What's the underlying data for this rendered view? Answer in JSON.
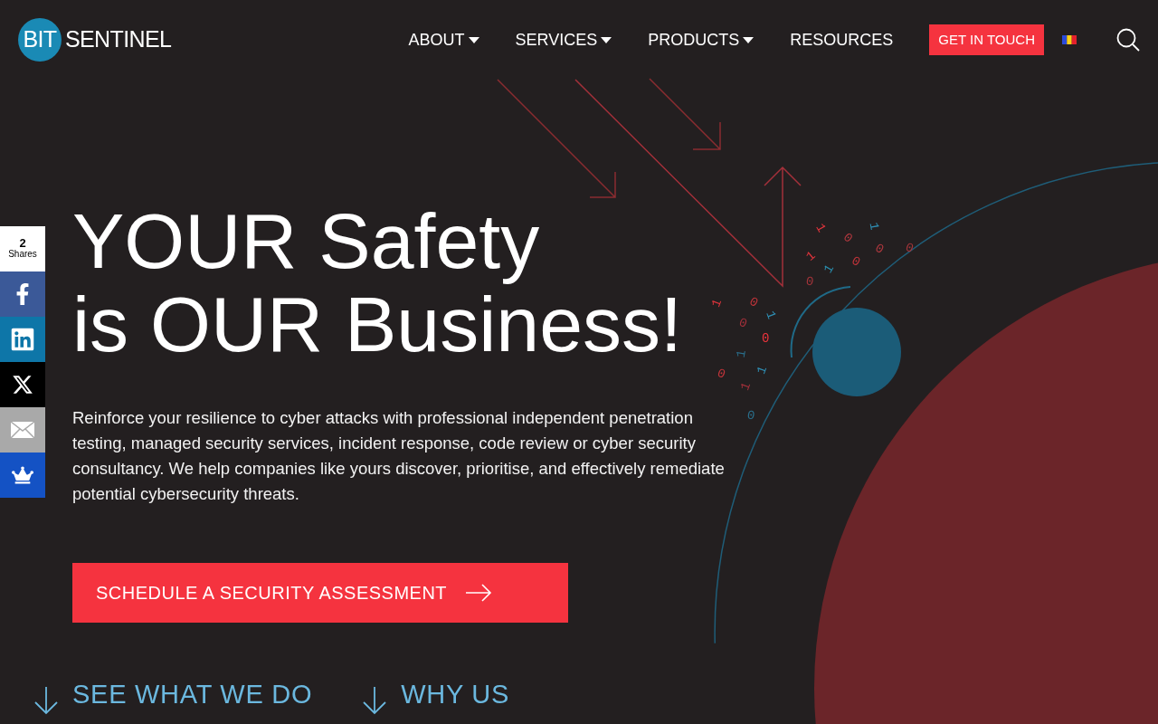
{
  "logo": {
    "mark": "BIT",
    "name": "SENTINEL"
  },
  "nav": [
    {
      "label": "ABOUT",
      "dropdown": true
    },
    {
      "label": "SERVICES",
      "dropdown": true
    },
    {
      "label": "PRODUCTS",
      "dropdown": true
    },
    {
      "label": "RESOURCES",
      "dropdown": false
    }
  ],
  "cta_nav": "GET IN TOUCH",
  "share_bar": {
    "count": "2",
    "label": "Shares",
    "buttons": [
      {
        "kind": "facebook"
      },
      {
        "kind": "linkedin"
      },
      {
        "kind": "x"
      },
      {
        "kind": "email"
      },
      {
        "kind": "crown"
      }
    ]
  },
  "hero": {
    "title_lines": [
      "YOUR Safety",
      "is OUR Business!"
    ],
    "text": "Reinforce your resilience to cyber attacks with professional independent penetration testing, managed security services, incident response, code review or cyber security consultancy. We help companies like yours discover, prioritise, and effectively remediate potential cybersecurity threats.",
    "button": "SCHEDULE A SECURITY ASSESSMENT"
  },
  "scroll_links": [
    "SEE WHAT WE DO",
    "WHY US"
  ],
  "binary_digits": [
    "1",
    "0",
    "1",
    "0",
    "0",
    "1",
    "1",
    "0",
    "0",
    "1",
    "0",
    "1",
    "0",
    "0",
    "1",
    "1",
    "0",
    "1",
    "0"
  ]
}
